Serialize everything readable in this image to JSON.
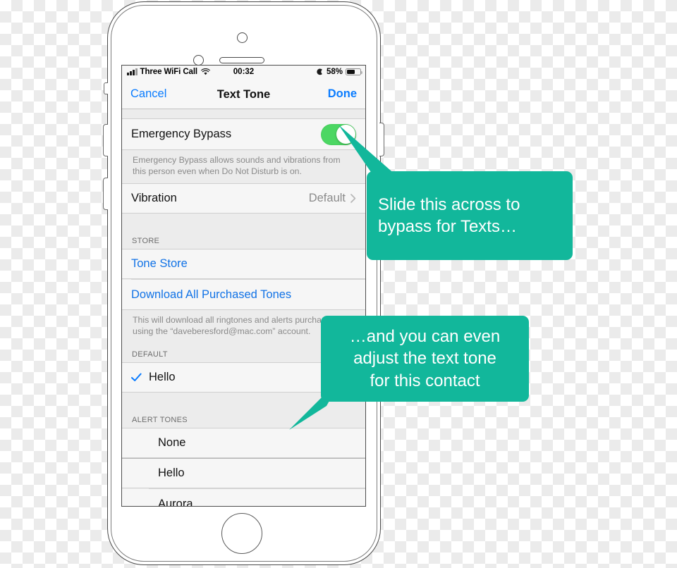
{
  "theme": {
    "accent_teal": "#12b79b",
    "ios_blue": "#0a7cff",
    "link_blue": "#1273e6",
    "toggle_green": "#4cd763"
  },
  "phone": {
    "hardware": {
      "front_camera": "front-camera",
      "proximity_sensor": "proximity-sensor",
      "earpiece_speaker": "earpiece-speaker",
      "home_button": "home-button",
      "mute_switch": "mute-switch",
      "volume_up": "volume-up-button",
      "volume_down": "volume-down-button",
      "power": "power-button"
    }
  },
  "status_bar": {
    "carrier": "Three WiFi Call",
    "wifi_icon": "wifi-icon",
    "signal_icon": "signal-bars-icon",
    "time": "00:32",
    "dnd_icon": "crescent-moon-icon",
    "battery_percent": "58%",
    "battery_level": 58,
    "battery_icon": "battery-icon"
  },
  "nav_bar": {
    "cancel_label": "Cancel",
    "title": "Text Tone",
    "done_label": "Done"
  },
  "sections": {
    "bypass": {
      "row_label": "Emergency Bypass",
      "toggle_state": "on",
      "footnote": "Emergency Bypass allows sounds and vibrations from this person even when Do Not Disturb is on.",
      "vibration_label": "Vibration",
      "vibration_value": "Default",
      "chevron_icon": "chevron-right-icon"
    },
    "store": {
      "header": "STORE",
      "tone_store_label": "Tone Store",
      "download_all_label": "Download All Purchased Tones",
      "footnote": "This will download all ringtones and alerts purchased using the “daveberesford@mac.com” account."
    },
    "default": {
      "header": "DEFAULT",
      "items": [
        {
          "label": "Hello",
          "selected": true,
          "check_icon": "checkmark-icon"
        }
      ]
    },
    "alert_tones": {
      "header": "ALERT TONES",
      "items": [
        {
          "label": "None",
          "selected": false
        },
        {
          "label": "Hello",
          "selected": false
        },
        {
          "label": "Aurora",
          "selected": false
        }
      ]
    }
  },
  "callouts": [
    {
      "id": "bypass",
      "text": "Slide this across to\nbypass for Texts…"
    },
    {
      "id": "texttone",
      "text": "…and you can even\nadjust the text tone\nfor this contact"
    }
  ]
}
